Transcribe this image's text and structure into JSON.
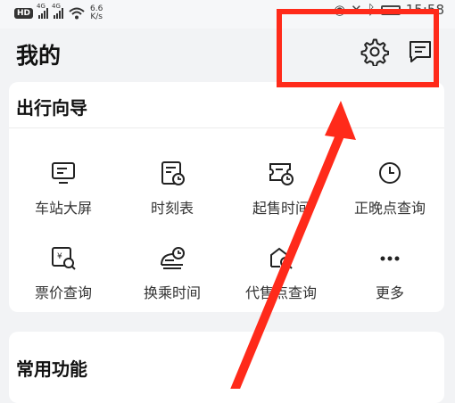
{
  "status_bar": {
    "hd": "HD",
    "sim1": "4G",
    "sim2": "4G",
    "speed_top": "6.6",
    "speed_unit": "K/s",
    "time": "15:58"
  },
  "header": {
    "title": "我的",
    "settings_icon": "gear-icon",
    "message_icon": "message-icon"
  },
  "travel_guide": {
    "title": "出行向导",
    "items": [
      {
        "label": "车站大屏",
        "icon": "screen-icon"
      },
      {
        "label": "时刻表",
        "icon": "timetable-icon"
      },
      {
        "label": "起售时间",
        "icon": "ticket-time-icon"
      },
      {
        "label": "正晚点查询",
        "icon": "clock-icon"
      },
      {
        "label": "票价查询",
        "icon": "fare-search-icon"
      },
      {
        "label": "换乘时间",
        "icon": "train-time-icon"
      },
      {
        "label": "代售点查询",
        "icon": "agency-search-icon"
      },
      {
        "label": "更多",
        "icon": "more-icon"
      }
    ]
  },
  "common_functions": {
    "title": "常用功能"
  },
  "colors": {
    "annotation": "#ff2a1a",
    "background": "#f2f3f5",
    "card": "#ffffff"
  }
}
